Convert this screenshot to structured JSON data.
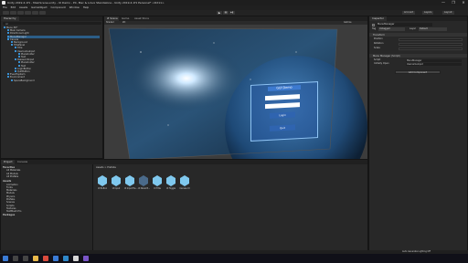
{
  "window": {
    "title": "Unity 2019.4.1f1 - MainScene.unity - UI Demo - PC, Mac & Linux Standalone - Unity 2019.4.1f1 Personal* <DX11>",
    "controls": [
      "—",
      "❐",
      "✕"
    ]
  },
  "menu": [
    "File",
    "Edit",
    "Assets",
    "GameObject",
    "Component",
    "Window",
    "Help"
  ],
  "toolbar": {
    "play_label": "▶",
    "pause_label": "❚❚",
    "step_label": "▶❚",
    "account_label": "Account",
    "layers_label": "Layers",
    "layout_label": "Layout"
  },
  "hierarchy": {
    "tab_label": "Hierarchy",
    "search_placeholder": "All",
    "items": [
      {
        "label": "Menu 3D*"
      },
      {
        "label": "Main Camera"
      },
      {
        "label": "Directional Light"
      },
      {
        "label": "MenuManager"
      },
      {
        "label": "Canvas"
      },
      {
        "label": "Background"
      },
      {
        "label": "TitlePanel"
      },
      {
        "label": "Title"
      },
      {
        "label": "UsernameInput"
      },
      {
        "label": "Placeholder"
      },
      {
        "label": "Text"
      },
      {
        "label": "PasswordInput"
      },
      {
        "label": "Placeholder"
      },
      {
        "label": "Text"
      },
      {
        "label": "LoginButton"
      },
      {
        "label": "QuitButton"
      },
      {
        "label": "EventSystem"
      },
      {
        "label": "Environment"
      },
      {
        "label": "SpaceBackground"
      }
    ]
  },
  "scene": {
    "tabs": [
      "# Scene",
      "Game",
      "Asset Store"
    ],
    "shaded_label": "Shaded",
    "mode_2d": "2D",
    "gizmos_label": "Gizmos"
  },
  "login_panel": {
    "title": "GUI Demo",
    "username_value": "",
    "password_value": "",
    "login_label": "Login",
    "quit_label": "Quit"
  },
  "inspector": {
    "tab_label": "Inspector",
    "object_name": "MenuManager",
    "tag_label": "Tag",
    "tag_value": "Untagged",
    "layer_label": "Layer",
    "layer_value": "Default",
    "transform_label": "Transform",
    "position_label": "Position",
    "rotation_label": "Rotation",
    "scale_label": "Scale",
    "component_label": "Menu Manager (Script)",
    "script_label": "Script",
    "script_value": "MenuManager",
    "field_label": "Initially Open",
    "field_value": "UsernameInput",
    "add_component": "Add Component"
  },
  "project": {
    "tabs": [
      "Project",
      "Console"
    ],
    "favorites_label": "Favorites",
    "favorites": [
      "All Materials",
      "All Models",
      "All Prefabs"
    ],
    "assets_label": "Assets",
    "folders": [
      "Animation",
      "Fonts",
      "Materials",
      "Models",
      "Physics",
      "Prefabs",
      "Scenes",
      "Scripts",
      "Textures",
      "TextMesh Pro"
    ],
    "packages_label": "Packages",
    "breadcrumb": "Assets > Prefabs",
    "assets": [
      {
        "label": "UI Button"
      },
      {
        "label": "UI Input"
      },
      {
        "label": "UI Input Fie..."
      },
      {
        "label": "UI Panel B..."
      },
      {
        "label": "UI Title"
      },
      {
        "label": "UI Toggle"
      },
      {
        "label": "Canvas UI"
      }
    ],
    "footer_path": "Auto Generate Lighting Off"
  },
  "colors": {
    "accent": "#2c5d87",
    "asset_cube": "#7fc8ee",
    "panel_blue": "#5aa0e0"
  }
}
